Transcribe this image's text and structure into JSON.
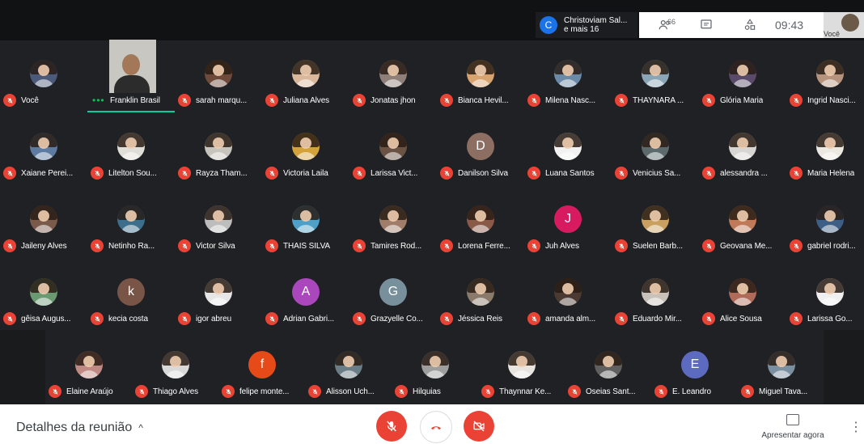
{
  "presenter_chip": {
    "initial": "C",
    "line1": "Christoviam Sal...",
    "line2": "e mais 16"
  },
  "infobar": {
    "people_count": "66",
    "time": "09:43",
    "self_label": "Você"
  },
  "participants": [
    {
      "name": "Você",
      "kind": "photo",
      "color": "#4a5a78"
    },
    {
      "name": "Franklin Brasil",
      "kind": "video",
      "color": "#c9c7c2",
      "speaking": true
    },
    {
      "name": "sarah marqu...",
      "kind": "photo",
      "color": "#6d4a3a"
    },
    {
      "name": "Juliana Alves",
      "kind": "photo",
      "color": "#d9b89c"
    },
    {
      "name": "Jonatas jhon",
      "kind": "photo",
      "color": "#8e7f79"
    },
    {
      "name": "Bianca Hevil...",
      "kind": "photo",
      "color": "#d7a36e"
    },
    {
      "name": "Milena Nasc...",
      "kind": "photo",
      "color": "#6b8aa8"
    },
    {
      "name": "THAYNARA ...",
      "kind": "photo",
      "color": "#8aa5b5"
    },
    {
      "name": "Glória Maria",
      "kind": "photo",
      "color": "#5a4a6a"
    },
    {
      "name": "Ingrid Nasci...",
      "kind": "photo",
      "color": "#b5937c"
    },
    {
      "name": "Xaiane Perei...",
      "kind": "photo",
      "color": "#5d7aa0"
    },
    {
      "name": "Litelton Sou...",
      "kind": "photo",
      "color": "#e0ded8"
    },
    {
      "name": "Rayza Tham...",
      "kind": "photo",
      "color": "#c7c3bd"
    },
    {
      "name": "Victoria Laila",
      "kind": "photo",
      "color": "#d4a23a"
    },
    {
      "name": "Larissa Vict...",
      "kind": "photo",
      "color": "#6a5244"
    },
    {
      "name": "Danilson Silva",
      "kind": "initial",
      "initial": "D",
      "color": "#8d6e63"
    },
    {
      "name": "Luana Santos",
      "kind": "photo",
      "color": "#f2f2f2"
    },
    {
      "name": "Venicius Sa...",
      "kind": "photo",
      "color": "#5c6a6e"
    },
    {
      "name": "alessandra ...",
      "kind": "photo",
      "color": "#d8d6d2"
    },
    {
      "name": "Maria Helena",
      "kind": "photo",
      "color": "#ece8e2"
    },
    {
      "name": "Jaileny Alves",
      "kind": "photo",
      "color": "#7a5a4a"
    },
    {
      "name": "Netinho Ra...",
      "kind": "photo",
      "color": "#3b6f8c"
    },
    {
      "name": "Victor Silva",
      "kind": "photo",
      "color": "#bdbdbd"
    },
    {
      "name": "THAIS SILVA",
      "kind": "photo",
      "color": "#4ea0c8"
    },
    {
      "name": "Tamires Rod...",
      "kind": "photo",
      "color": "#a07d6a"
    },
    {
      "name": "Lorena Ferre...",
      "kind": "photo",
      "color": "#8a5a48"
    },
    {
      "name": "Juh Alves",
      "kind": "initial",
      "initial": "J",
      "color": "#d81b60"
    },
    {
      "name": "Suelen Barb...",
      "kind": "photo",
      "color": "#c9a060"
    },
    {
      "name": "Geovana Me...",
      "kind": "photo",
      "color": "#c07a5a"
    },
    {
      "name": "gabriel rodri...",
      "kind": "photo",
      "color": "#3d5f85"
    },
    {
      "name": "gêisa Augus...",
      "kind": "photo",
      "color": "#6a9a72"
    },
    {
      "name": "kecia costa",
      "kind": "initial",
      "initial": "k",
      "color": "#795548"
    },
    {
      "name": "igor abreu",
      "kind": "photo",
      "color": "#e6e6e6"
    },
    {
      "name": "Adrian Gabri...",
      "kind": "initial",
      "initial": "A",
      "color": "#ab47bc"
    },
    {
      "name": "Grazyelle Co...",
      "kind": "initial",
      "initial": "G",
      "color": "#78909c"
    },
    {
      "name": "Jéssica Reis",
      "kind": "photo",
      "color": "#8a7a6a"
    },
    {
      "name": "amanda alm...",
      "kind": "photo",
      "color": "#4a3a32"
    },
    {
      "name": "Eduardo Mir...",
      "kind": "photo",
      "color": "#c8c2ba"
    },
    {
      "name": "Alice Sousa",
      "kind": "photo",
      "color": "#b06a5a"
    },
    {
      "name": "Larissa Go...",
      "kind": "photo",
      "color": "#f0f0f0"
    },
    {
      "name": "Elaine Araújo",
      "kind": "photo",
      "color": "#c08a84"
    },
    {
      "name": "Thiago Alves",
      "kind": "photo",
      "color": "#d9d9d9"
    },
    {
      "name": "felipe monte...",
      "kind": "initial",
      "initial": "f",
      "color": "#e64a19"
    },
    {
      "name": "Alisson Uch...",
      "kind": "photo",
      "color": "#6b7d86"
    },
    {
      "name": "Hilquias",
      "kind": "photo",
      "color": "#9e9e9e"
    },
    {
      "name": "Thaynnar Ke...",
      "kind": "photo",
      "color": "#e8e4df"
    },
    {
      "name": "Oseias Sant...",
      "kind": "photo",
      "color": "#606060"
    },
    {
      "name": "E. Leandro",
      "kind": "initial",
      "initial": "E",
      "color": "#5c6bc0"
    },
    {
      "name": "Miguel Tava...",
      "kind": "photo",
      "color": "#7a8fa0"
    }
  ],
  "bottom": {
    "details_label": "Detalhes da reunião",
    "present_label": "Apresentar agora"
  }
}
